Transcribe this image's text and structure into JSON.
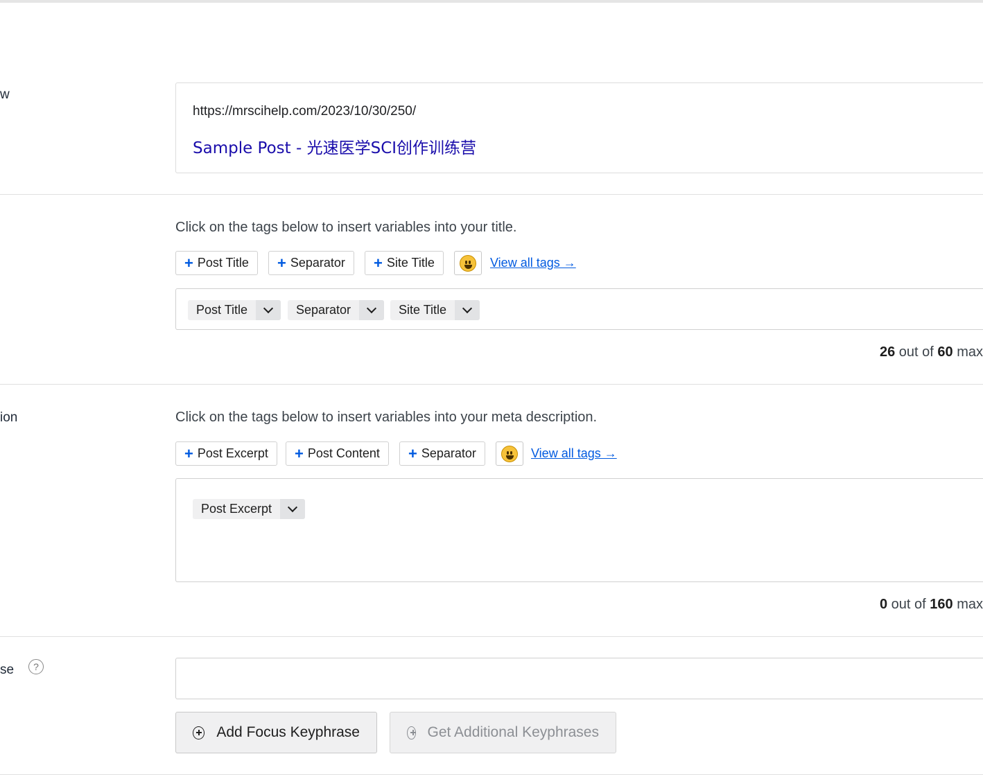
{
  "labels": {
    "snippet_preview_fragment": "w",
    "meta_description_fragment": "ion",
    "focus_keyphrase_fragment": "se"
  },
  "preview": {
    "url": "https://mrscihelp.com/2023/10/30/250/",
    "title": "Sample Post - 光速医学SCI创作训练营"
  },
  "title_section": {
    "hint": "Click on the tags below to insert variables into your title.",
    "tag_buttons": [
      "Post Title",
      "Separator",
      "Site Title"
    ],
    "view_all": "View all tags →",
    "chips": [
      "Post Title",
      "Separator",
      "Site Title"
    ],
    "counter": {
      "current": "26",
      "mid": " out of ",
      "max": "60",
      "suffix": " max"
    }
  },
  "description_section": {
    "hint": "Click on the tags below to insert variables into your meta description.",
    "tag_buttons": [
      "Post Excerpt",
      "Post Content",
      "Separator"
    ],
    "view_all": "View all tags →",
    "chips": [
      "Post Excerpt"
    ],
    "counter": {
      "current": "0",
      "mid": " out of ",
      "max": "160",
      "suffix": " max"
    }
  },
  "keyphrase_section": {
    "help": "?",
    "add_button": "Add Focus Keyphrase",
    "get_button": "Get Additional Keyphrases"
  },
  "icons": {
    "plus": "+",
    "emoji": "grinning-face-icon",
    "chevron": "chevron-down-icon",
    "circle_plus": "circle-plus-icon"
  },
  "colors": {
    "accent": "#005ae0",
    "preview_title": "#1a0dab"
  }
}
